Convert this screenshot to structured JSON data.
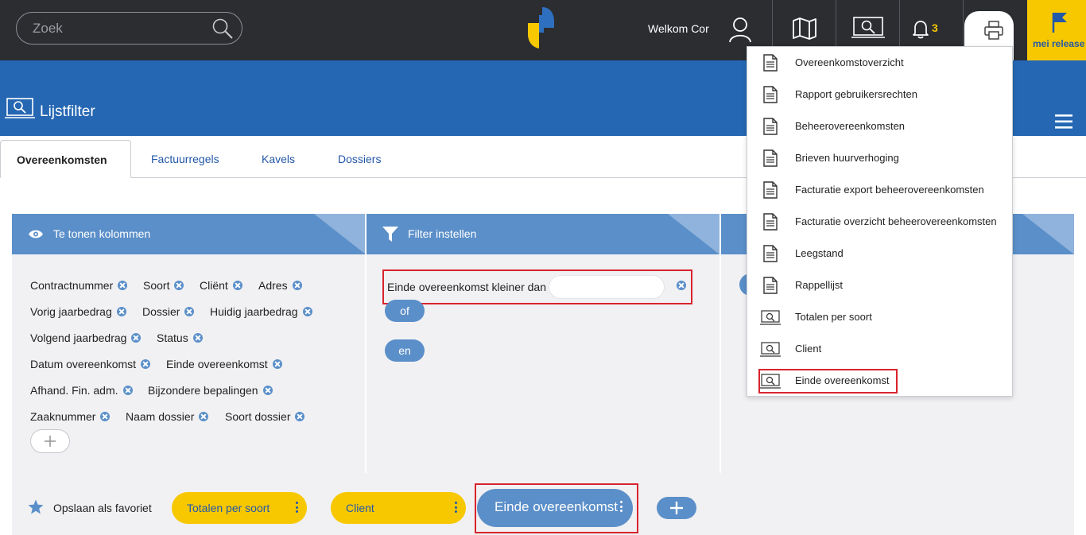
{
  "topbar": {
    "search_placeholder": "Zoek",
    "welcome": "Welkom Cor",
    "notification_count": "3",
    "release_label": "mei release"
  },
  "header": {
    "title": "Lijstfilter"
  },
  "tabs": [
    {
      "label": "Overeenkomsten",
      "active": true
    },
    {
      "label": "Factuurregels"
    },
    {
      "label": "Kavels"
    },
    {
      "label": "Dossiers"
    }
  ],
  "columns_panel": {
    "title": "Te tonen kolommen",
    "rows": [
      [
        "Contractnummer",
        "Soort",
        "Cliënt",
        "Adres"
      ],
      [
        "Vorig jaarbedrag",
        "Dossier",
        "Huidig jaarbedrag"
      ],
      [
        "Volgend jaarbedrag",
        "Status"
      ],
      [
        "Datum overeenkomst",
        "Einde overeenkomst"
      ],
      [
        "Afhand. Fin. adm.",
        "Bijzondere bepalingen"
      ],
      [
        "Zaaknummer",
        "Naam dossier",
        "Soort dossier"
      ]
    ]
  },
  "filter_panel": {
    "title": "Filter instellen",
    "condition": "Einde overeenkomst kleiner dan",
    "value": "",
    "or_label": "of",
    "and_label": "en"
  },
  "favorites": {
    "label": "Opslaan als favoriet",
    "items": [
      "Totalen per soort",
      "Client",
      "Einde overeenkomst"
    ],
    "active_index": 2
  },
  "print_menu": {
    "items": [
      {
        "label": "Overeenkomstoverzicht",
        "icon": "document-icon"
      },
      {
        "label": "Rapport gebruikersrechten",
        "icon": "document-icon"
      },
      {
        "label": "Beheerovereenkomsten",
        "icon": "document-icon"
      },
      {
        "label": "Brieven huurverhoging",
        "icon": "document-icon"
      },
      {
        "label": "Facturatie export beheerovereenkomsten",
        "icon": "document-icon"
      },
      {
        "label": "Facturatie overzicht beheerovereenkomsten",
        "icon": "document-icon"
      },
      {
        "label": "Leegstand",
        "icon": "document-icon"
      },
      {
        "label": "Rappellijst",
        "icon": "document-icon"
      },
      {
        "label": "Totalen per soort",
        "icon": "list-filter-icon"
      },
      {
        "label": "Client",
        "icon": "list-filter-icon"
      },
      {
        "label": "Einde overeenkomst",
        "icon": "list-filter-icon"
      }
    ],
    "highlighted_index": 10
  },
  "colors": {
    "topbar": "#2b2d31",
    "header_blue": "#2567b3",
    "panel_blue": "#5b8fc9",
    "accent_yellow": "#f7c800",
    "highlight_red": "#d9232d"
  }
}
